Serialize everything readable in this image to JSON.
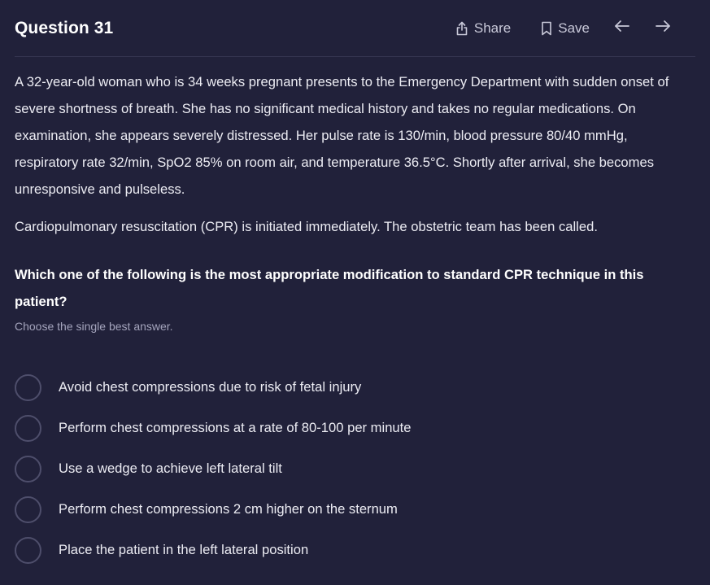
{
  "header": {
    "title": "Question 31",
    "share_label": "Share",
    "save_label": "Save",
    "icons": {
      "share": "share-icon",
      "save": "bookmark-icon",
      "prev": "arrow-left-icon",
      "next": "arrow-right-icon"
    }
  },
  "question": {
    "stem_paragraph_1": "A 32-year-old woman who is 34 weeks pregnant presents to the Emergency Department with sudden onset of severe shortness of breath. She has no significant medical history and takes no regular medications. On examination, she appears severely distressed. Her pulse rate is 130/min, blood pressure 80/40 mmHg, respiratory rate 32/min, SpO2 85% on room air, and temperature 36.5°C. Shortly after arrival, she becomes unresponsive and pulseless.",
    "stem_paragraph_2": "Cardiopulmonary resuscitation (CPR) is initiated immediately. The obstetric team has been called.",
    "prompt": "Which one of the following is the most appropriate modification to standard CPR technique in this patient?",
    "instruction": "Choose the single best answer."
  },
  "options": [
    {
      "label": "Avoid chest compressions due to risk of fetal injury"
    },
    {
      "label": "Perform chest compressions at a rate of 80-100 per minute"
    },
    {
      "label": "Use a wedge to achieve left lateral tilt"
    },
    {
      "label": "Perform chest compressions 2 cm higher on the sternum"
    },
    {
      "label": "Place the patient in the left lateral position"
    }
  ],
  "colors": {
    "background": "#21213a",
    "text": "#ececf3",
    "muted": "#a4a4bc",
    "radio_border": "#4e4e6b"
  }
}
